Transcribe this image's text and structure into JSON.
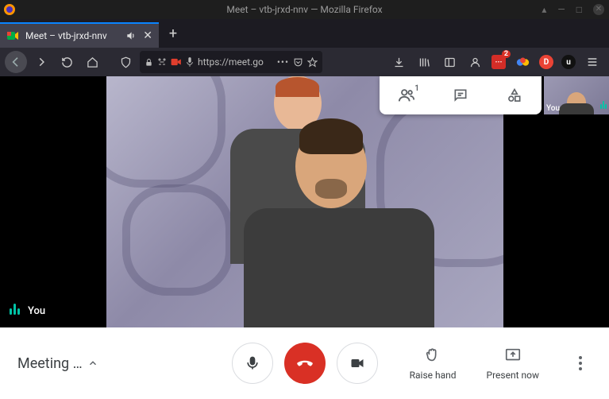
{
  "os": {
    "window_title": "Meet – vtb-jrxd-nnv — Mozilla Firefox"
  },
  "tabs": [
    {
      "title": "Meet – vtb-jrxd-nnv"
    }
  ],
  "urlbar": {
    "url_display": "https://meet.go"
  },
  "extensions": {
    "lastpass_badge": "2",
    "lastpass_glyph": "···",
    "d_glyph": "D",
    "u_glyph": "u"
  },
  "meet": {
    "main_label": "You",
    "self_label": "You",
    "people_count_sup": "1",
    "bottom": {
      "meeting_info_label": "Meeting …",
      "raise_hand": "Raise hand",
      "present_now": "Present now"
    }
  }
}
